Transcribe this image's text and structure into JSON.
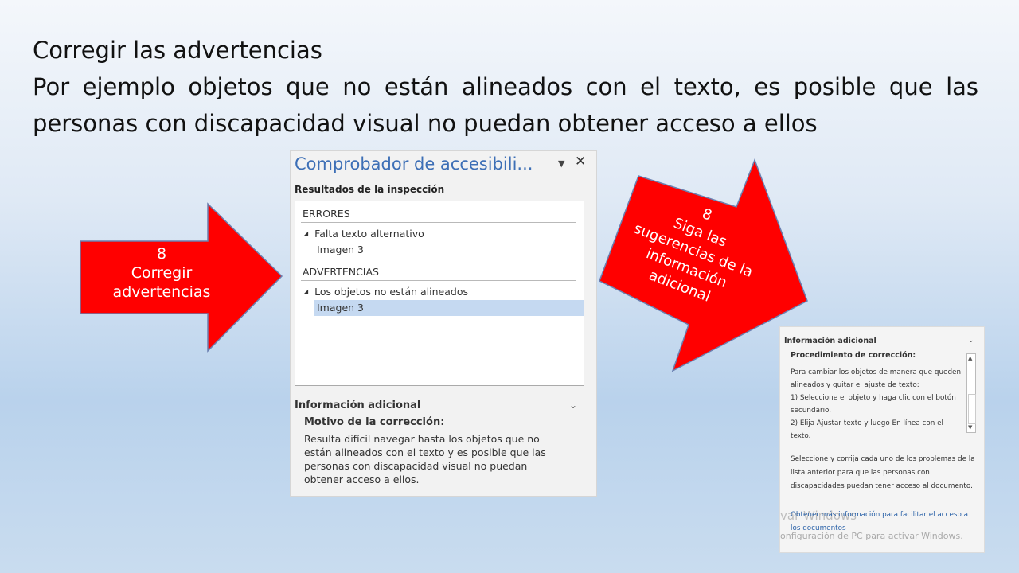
{
  "slide": {
    "heading": "Corregir las advertencias",
    "body": "Por ejemplo objetos que no están alineados con el texto, es posible que las personas con discapacidad visual no puedan obtener acceso a ellos"
  },
  "arrow_left": {
    "number": "8",
    "line1": "Corregir",
    "line2": "advertencias",
    "color": "#ff0000"
  },
  "arrow_right": {
    "number": "8",
    "line1": "Siga las",
    "line2": "sugerencias de la",
    "line3": "información",
    "line4": "adicional",
    "color": "#ff0000"
  },
  "pane": {
    "title": "Comprobador de accesibili...",
    "dropdown_icon": "caret-down-icon",
    "close_icon": "close-icon",
    "results_label": "Resultados de la inspección",
    "errors_label": "ERRORES",
    "error_item": "Falta texto alternativo",
    "error_sub": "Imagen 3",
    "warnings_label": "ADVERTENCIAS",
    "warning_item": "Los objetos no están alineados",
    "warning_sub": "Imagen 3",
    "info_header": "Información adicional",
    "motivo_label": "Motivo de la corrección:",
    "motivo_text": "Resulta difícil navegar hasta los objetos que no están alineados con el texto y es posible que las personas con discapacidad visual no puedan obtener acceso a ellos."
  },
  "info_panel": {
    "header": "Información adicional",
    "procedure_label": "Procedimiento de corrección:",
    "steps": "Para cambiar los objetos de manera que queden alineados y quitar el ajuste de texto:\n1) Seleccione el objeto y haga clic con el botón secundario.\n2) Elija Ajustar texto y luego En línea con el texto.",
    "note": "Seleccione y corrija cada uno de los problemas de la lista anterior para que las personas con discapacidades puedan tener acceso al documento.",
    "link": "Obtener más información para facilitar el acceso a los documentos",
    "watermark_1": "var Windows",
    "watermark_2": "onfiguración de PC para activar Windows."
  }
}
